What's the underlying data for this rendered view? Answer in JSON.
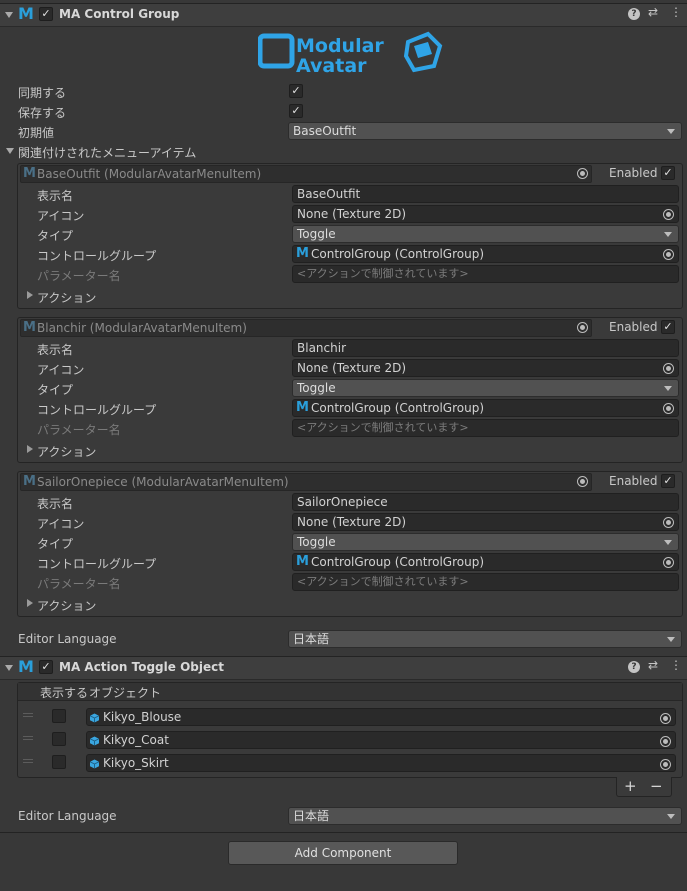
{
  "control_group": {
    "title": "MA Control Group",
    "enabled": true,
    "logo_text_1": "Modular",
    "logo_text_2": "Avatar",
    "sync_label": "同期する",
    "save_label": "保存する",
    "initial_label": "初期値",
    "initial_value": "BaseOutfit",
    "menu_items_label": "関連付けされたメニューアイテム",
    "editor_language_label": "Editor Language",
    "editor_language_value": "日本語"
  },
  "menu_items": [
    {
      "header": "BaseOutfit (ModularAvatarMenuItem)",
      "enabled_label": "Enabled",
      "display_name_label": "表示名",
      "display_name": "BaseOutfit",
      "icon_label": "アイコン",
      "icon_value": "None (Texture 2D)",
      "type_label": "タイプ",
      "type_value": "Toggle",
      "control_group_label": "コントロールグループ",
      "control_group_value": "ControlGroup (ControlGroup)",
      "parameter_label": "パラメーター名",
      "parameter_value": "<アクションで制御されています>",
      "action_label": "アクション"
    },
    {
      "header": "Blanchir (ModularAvatarMenuItem)",
      "enabled_label": "Enabled",
      "display_name_label": "表示名",
      "display_name": "Blanchir",
      "icon_label": "アイコン",
      "icon_value": "None (Texture 2D)",
      "type_label": "タイプ",
      "type_value": "Toggle",
      "control_group_label": "コントロールグループ",
      "control_group_value": "ControlGroup (ControlGroup)",
      "parameter_label": "パラメーター名",
      "parameter_value": "<アクションで制御されています>",
      "action_label": "アクション"
    },
    {
      "header": "SailorOnepiece (ModularAvatarMenuItem)",
      "enabled_label": "Enabled",
      "display_name_label": "表示名",
      "display_name": "SailorOnepiece",
      "icon_label": "アイコン",
      "icon_value": "None (Texture 2D)",
      "type_label": "タイプ",
      "type_value": "Toggle",
      "control_group_label": "コントロールグループ",
      "control_group_value": "ControlGroup (ControlGroup)",
      "parameter_label": "パラメーター名",
      "parameter_value": "<アクションで制御されています>",
      "action_label": "アクション"
    }
  ],
  "toggle_object": {
    "title": "MA Action Toggle Object",
    "enabled": true,
    "col_show": "表示する",
    "col_object": "オブジェクト",
    "objects": [
      "Kikyo_Blouse",
      "Kikyo_Coat",
      "Kikyo_Skirt"
    ],
    "add_symbol": "+",
    "remove_symbol": "−",
    "editor_language_label": "Editor Language",
    "editor_language_value": "日本語"
  },
  "add_component_label": "Add Component",
  "check_glyph": "✓",
  "colors": {
    "accent": "#2a9fdb",
    "background": "#383838"
  }
}
